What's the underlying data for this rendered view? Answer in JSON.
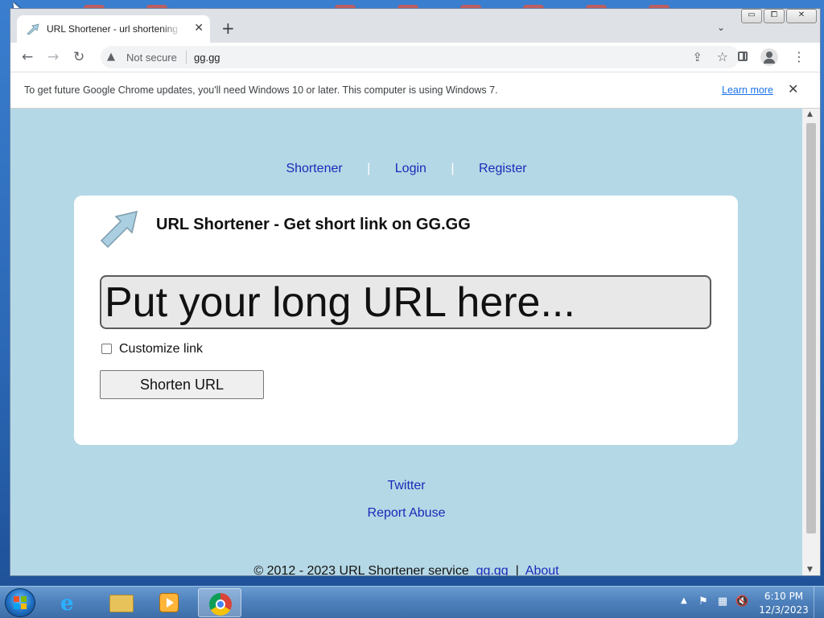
{
  "browser": {
    "tab_title": "URL Shortener - url shortening se",
    "tab_close_glyph": "✕",
    "new_tab_glyph": "+",
    "tab_search_glyph": "⌄",
    "security_label": "Not secure",
    "url": "gg.gg",
    "window_controls": {
      "minimize": "▭",
      "maximize": "⧠",
      "close": "✕"
    },
    "icons": [
      "back-arrow-icon",
      "forward-arrow-icon",
      "reload-icon",
      "warning-icon",
      "share-icon",
      "star-icon",
      "side-panel-icon",
      "profile-icon",
      "menu-icon"
    ]
  },
  "infobar": {
    "message": "To get future Google Chrome updates, you'll need Windows 10 or later. This computer is using Windows 7.",
    "learn_more": "Learn more",
    "close_glyph": "✕"
  },
  "page": {
    "nav": {
      "shortener": "Shortener",
      "sep1": "|",
      "login": "Login",
      "sep2": "|",
      "register": "Register"
    },
    "card_title": "URL Shortener - Get short link on GG.GG",
    "url_placeholder": "Put your long URL here...",
    "customize_label": "Customize link",
    "shorten_button": "Shorten URL",
    "twitter": "Twitter",
    "report_abuse": "Report Abuse",
    "footer": {
      "copyright": "© 2012 - 2023 URL Shortener service",
      "link1": "gg.gg",
      "sep": "|",
      "link2": "About"
    }
  },
  "taskbar": {
    "time": "6:10 PM",
    "date": "12/3/2023",
    "apps": [
      "start-button",
      "internet-explorer",
      "file-explorer",
      "media-player",
      "google-chrome"
    ]
  },
  "colors": {
    "page_background": "#b5d8e6",
    "link": "#1a2ab8",
    "infobar_link": "#1a73e8"
  }
}
